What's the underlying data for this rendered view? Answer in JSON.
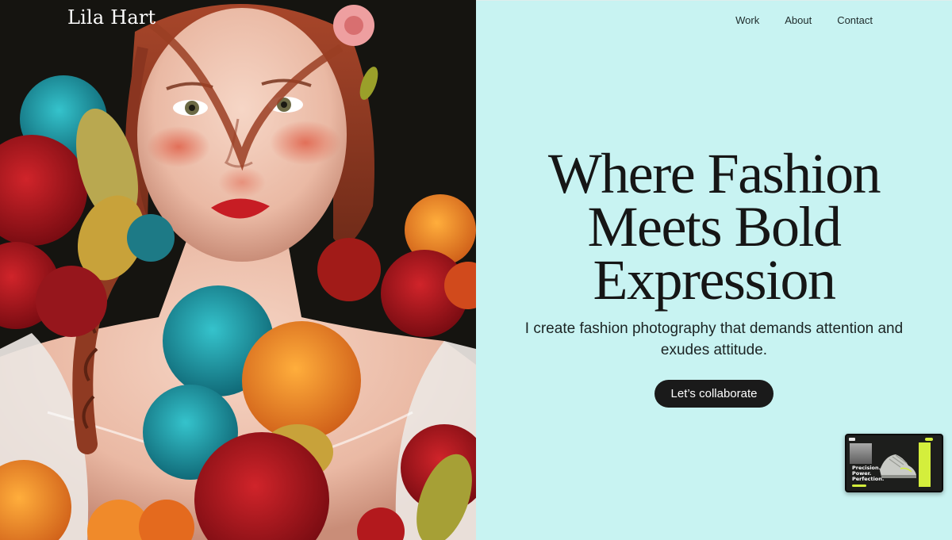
{
  "brand": {
    "name": "Lila Hart"
  },
  "nav": {
    "items": [
      "Work",
      "About",
      "Contact"
    ]
  },
  "hero": {
    "title_line1": "Where Fashion",
    "title_line2": "Meets Bold",
    "title_line3": "Expression",
    "subtitle": "I create fashion photography that demands attention and exudes attitude.",
    "cta_label": "Let’s collaborate"
  },
  "preview_card": {
    "line1": "Precision.",
    "line2": "Power.",
    "line3": "Perfection."
  },
  "colors": {
    "right_panel_bg": "#c8f3f2",
    "button_bg": "#1a1a1a",
    "accent_lime": "#d4ee3c"
  }
}
